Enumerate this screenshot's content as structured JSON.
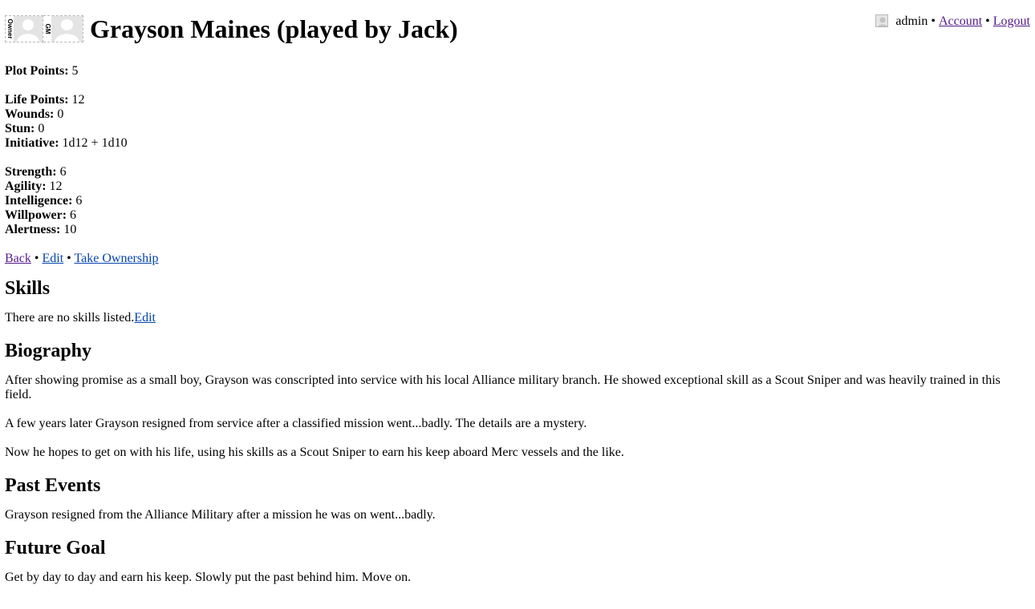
{
  "userbar": {
    "username": "admin",
    "separator": "•",
    "account_label": "Account",
    "logout_label": "Logout"
  },
  "header": {
    "owner_label": "Owner",
    "gm_label": "GM",
    "title": "Grayson Maines (played by Jack)"
  },
  "stats": {
    "plot_points_label": "Plot Points:",
    "plot_points": "5",
    "life_points_label": "Life Points:",
    "life_points": "12",
    "wounds_label": "Wounds:",
    "wounds": "0",
    "stun_label": "Stun:",
    "stun": "0",
    "initiative_label": "Initiative:",
    "initiative": "1d12 + 1d10",
    "strength_label": "Strength:",
    "strength": "6",
    "agility_label": "Agility:",
    "agility": "12",
    "intelligence_label": "Intelligence:",
    "intelligence": "6",
    "willpower_label": "Willpower:",
    "willpower": "6",
    "alertness_label": "Alertness:",
    "alertness": "10"
  },
  "actions": {
    "back_label": "Back",
    "edit_label": "Edit",
    "take_ownership_label": "Take Ownership",
    "separator": "•"
  },
  "skills": {
    "heading": "Skills",
    "empty_text": "There are no skills listed.",
    "edit_label": "Edit"
  },
  "biography": {
    "heading": "Biography",
    "paragraphs": [
      "After showing promise as a small boy, Grayson was conscripted into service with his local Alliance military branch. He showed exceptional skill as a Scout Sniper and was heavily trained in this field.",
      "A few years later Grayson resigned from service after a classified mission went...badly. The details are a mystery.",
      "Now he hopes to get on with his life, using his skills as a Scout Sniper to earn his keep aboard Merc vessels and the like."
    ]
  },
  "past_events": {
    "heading": "Past Events",
    "text": "Grayson resigned from the Alliance Military after a mission he was on went...badly."
  },
  "future_goal": {
    "heading": "Future Goal",
    "text": "Get by day to day and earn his keep. Slowly put the past behind him. Move on."
  },
  "colors": {
    "link": "#0645ad",
    "visited_link": "#551a8b",
    "avatar_border": "#b8b8b8"
  },
  "icons": [
    "user-avatar-icon",
    "owner-avatar-icon",
    "gm-avatar-icon"
  ]
}
